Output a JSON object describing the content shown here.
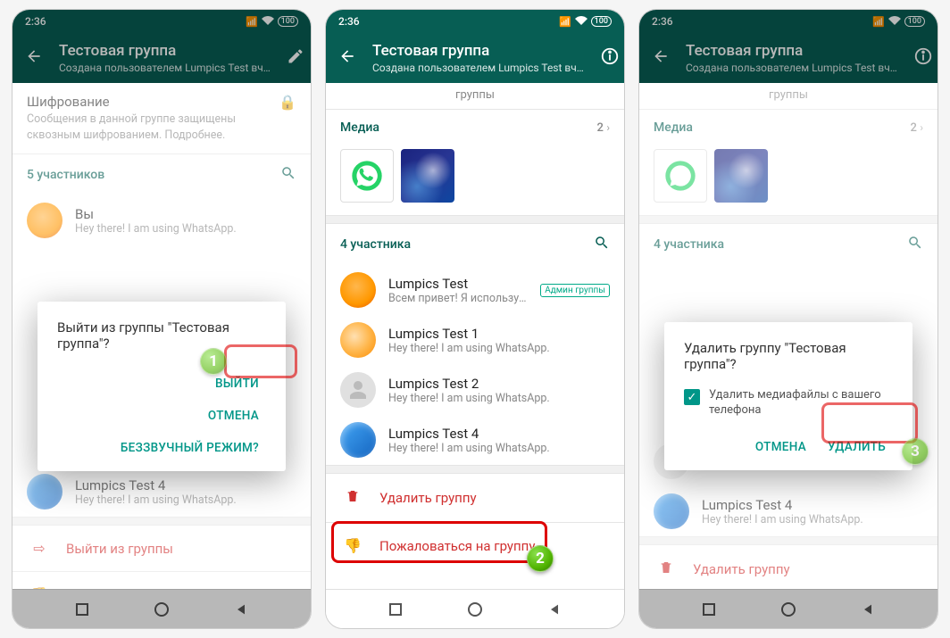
{
  "status": {
    "time": "2:36",
    "battery": "100"
  },
  "appbar": {
    "title": "Тестовая группа",
    "subtitle": "Создана пользователем Lumpics Test вч…"
  },
  "truncated_top": "группы",
  "encryption": {
    "title": "Шифрование",
    "sub": "Сообщения в данной группе защищены сквозным шифрованием. Подробнее."
  },
  "media": {
    "label": "Медиа",
    "count": "2"
  },
  "members1": {
    "header": "5 участников"
  },
  "members2": {
    "header": "4 участника"
  },
  "you": {
    "name": "Вы",
    "status": "Hey there! I am using WhatsApp."
  },
  "admin_badge": "Админ группы",
  "m_lumpics": {
    "name": "Lumpics Test",
    "status": "Всем привет! Я использую WhatsApp."
  },
  "m_l1": {
    "name": "Lumpics Test 1",
    "status": "Hey there! I am using WhatsApp."
  },
  "m_l2": {
    "name": "Lumpics Test 2",
    "status": "Hey there! I am using WhatsApp."
  },
  "m_l4": {
    "name": "Lumpics Test 4",
    "status": "Hey there! I am using WhatsApp."
  },
  "actions": {
    "exit": "Выйти из группы",
    "delete": "Удалить группу",
    "report": "Пожаловаться на группу"
  },
  "dlg1": {
    "title": "Выйти из группы \"Тестовая группа\"?",
    "exit": "ВЫЙТИ",
    "cancel": "ОТМЕНА",
    "mute": "БЕЗЗВУЧНЫЙ РЕЖИМ?"
  },
  "dlg3": {
    "title": "Удалить группу \"Тестовая группа\"?",
    "check": "Удалить медиафайлы с вашего телефона",
    "cancel": "ОТМЕНА",
    "delete": "УДАЛИТЬ"
  },
  "badges": {
    "n1": "1",
    "n2": "2",
    "n3": "3"
  }
}
